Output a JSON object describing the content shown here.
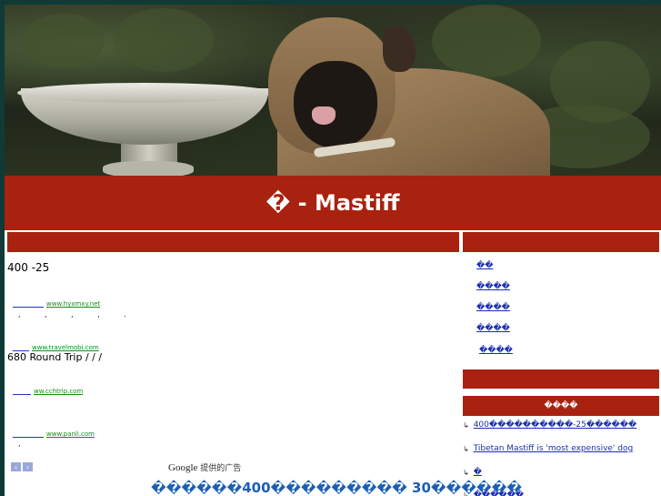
{
  "header": {
    "title": "� - Mastiff"
  },
  "main": {
    "intro": "400        -25",
    "ads": [
      {
        "url": "www.hyxmxy.net"
      },
      {
        "url": "www.travelmobi.com"
      },
      {
        "url": "ww.cchtrip.com"
      },
      {
        "url": "www.panli.com"
      }
    ],
    "ad1_dots": ",   ,   ,   ,   .",
    "ad2_text": "680 Round Trip  /  /  /",
    "ad4_dots": ",",
    "google_brand": "Google",
    "google_suffix": " 提供的广告",
    "prev_icon": "‹",
    "next_icon": "›",
    "headline": "������400��������� 30������"
  },
  "sidebar": {
    "nav": [
      "��",
      "����",
      "����",
      "����",
      "����"
    ],
    "section_title": "����",
    "items": [
      "400����������-25������",
      "Tibetan Mastiff is 'most expensive' dog",
      "�",
      "������"
    ],
    "item_icon": "↳"
  },
  "colors": {
    "accent": "#a8220f",
    "page_bg": "#0f3a36",
    "link": "#1a2fb0",
    "ad_url": "#1a8a1a",
    "headline": "#1a5fb4"
  }
}
